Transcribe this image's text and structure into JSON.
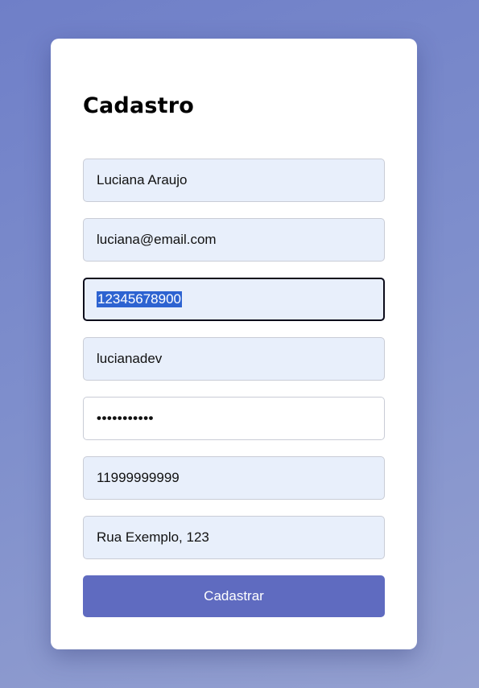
{
  "form": {
    "title": "Cadastro",
    "fields": [
      {
        "value": "Luciana Araujo"
      },
      {
        "value": "luciana@email.com"
      },
      {
        "value": "12345678900",
        "selected": true
      },
      {
        "value": "lucianadev"
      },
      {
        "value": "•••••••••••",
        "type": "password"
      },
      {
        "value": "11999999999"
      },
      {
        "value": "Rua Exemplo, 123"
      }
    ],
    "submit_label": "Cadastrar"
  },
  "colors": {
    "background_gradient_start": "#6f7fc8",
    "background_gradient_end": "#94a0d0",
    "field_fill": "#e8effb",
    "button_fill": "#5f6bc0",
    "selection": "#2d63d1"
  }
}
